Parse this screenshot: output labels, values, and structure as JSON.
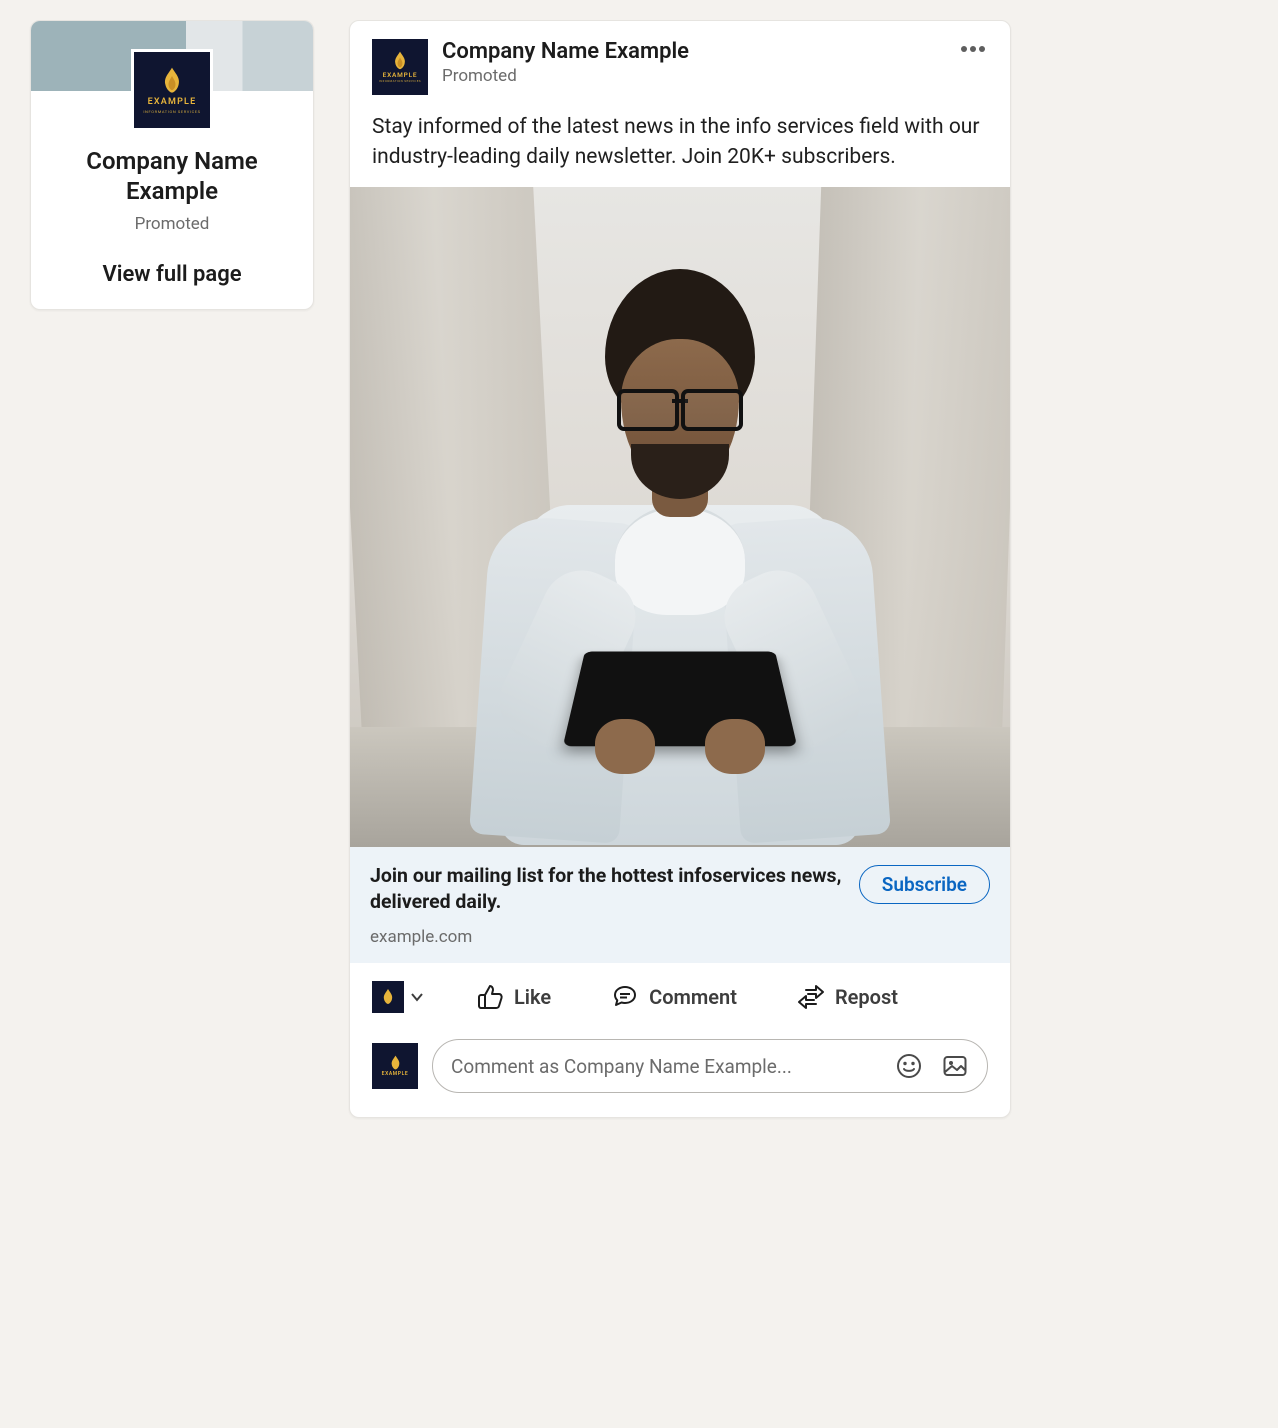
{
  "brand": {
    "logo_line1": "EXAMPLE",
    "logo_line2": "INFORMATION SERVICES"
  },
  "sidebar": {
    "company_name": "Company Name Example",
    "promoted_label": "Promoted",
    "view_full_page": "View full page"
  },
  "post": {
    "company_name": "Company Name Example",
    "promoted_label": "Promoted",
    "body_text": "Stay informed of the latest news in the info services field with our industry-leading daily newsletter. Join 20K+ subscribers.",
    "cta_headline": "Join our mailing list for the hottest infoservices news, delivered daily.",
    "cta_domain": "example.com",
    "cta_button": "Subscribe",
    "actions": {
      "like": "Like",
      "comment": "Comment",
      "repost": "Repost"
    },
    "comment_placeholder": "Comment as Company Name Example..."
  }
}
